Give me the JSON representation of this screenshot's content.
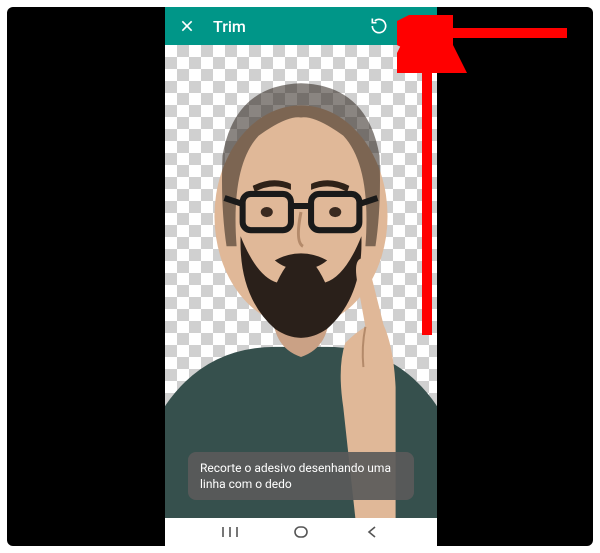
{
  "appbar": {
    "title": "Trim",
    "close_label": "Close",
    "rotate_label": "Rotate",
    "menu_label": "More options"
  },
  "toast": {
    "text": "Recorte o adesivo desenhando uma linha com o dedo"
  },
  "nav": {
    "recents": "Recents",
    "home": "Home",
    "back": "Back"
  },
  "colors": {
    "accent": "#009688",
    "arrow": "#FF0000"
  }
}
